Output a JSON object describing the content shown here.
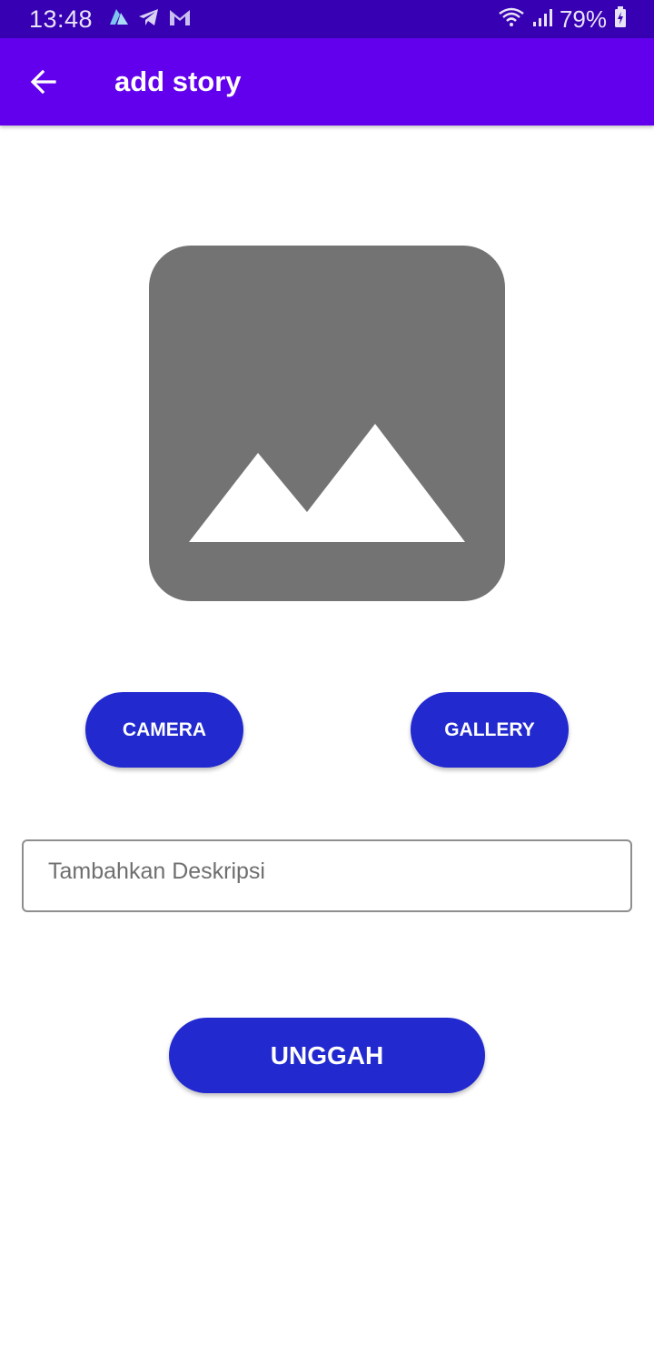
{
  "status_bar": {
    "time": "13:48",
    "battery": "79%",
    "notification_icons": [
      "azure-icon",
      "telegram-icon",
      "gmail-icon"
    ]
  },
  "app_bar": {
    "title": "add story",
    "back_icon": "arrow-left-icon"
  },
  "preview": {
    "icon": "image-placeholder-icon"
  },
  "buttons": {
    "camera": "CAMERA",
    "gallery": "GALLERY",
    "upload": "UNGGAH"
  },
  "description": {
    "placeholder": "Tambahkan Deskripsi",
    "value": ""
  },
  "colors": {
    "status_bar": "#3700b3",
    "app_bar": "#6200ee",
    "button": "#2129cf",
    "placeholder_bg": "#737373"
  }
}
